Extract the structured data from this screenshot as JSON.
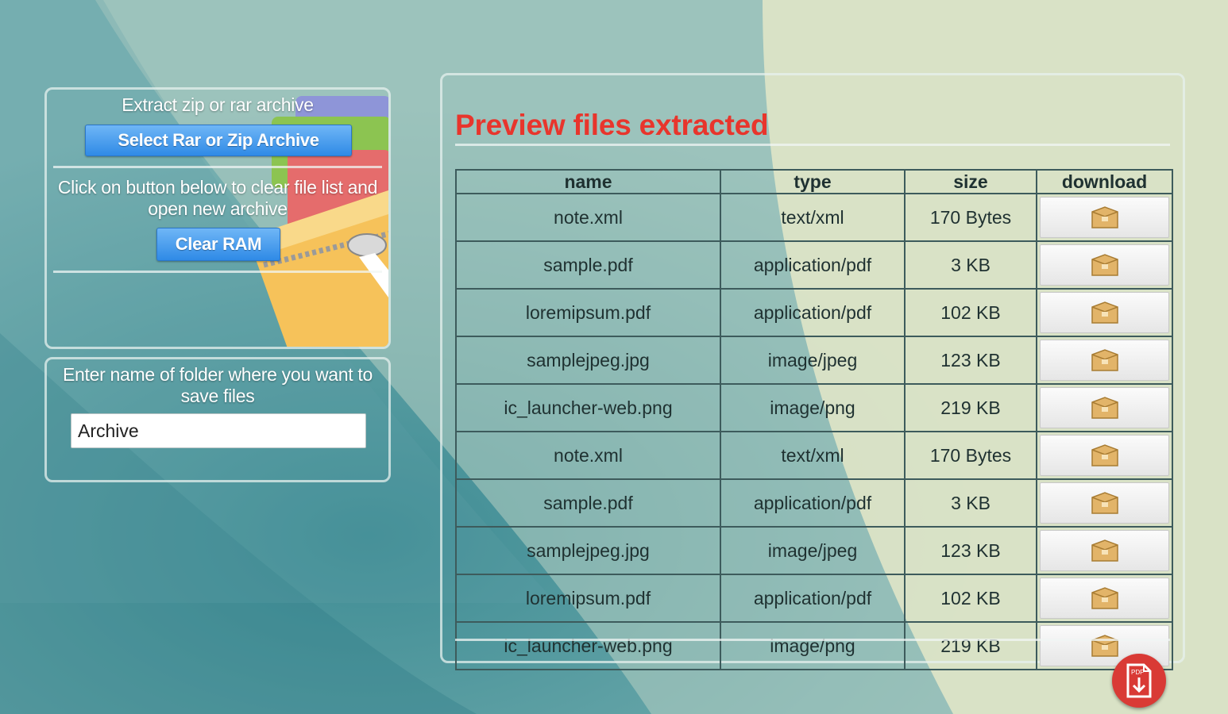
{
  "extract": {
    "title": "Extract zip or rar archive",
    "select_button": "Select Rar or Zip Archive",
    "clear_instruction": "Click on button below to clear file list and open new archive",
    "clear_button": "Clear RAM"
  },
  "folder": {
    "instruction": "Enter name of folder where you want to save files",
    "value": "Archive"
  },
  "preview": {
    "title": "Preview files extracted",
    "columns": [
      "name",
      "type",
      "size",
      "download"
    ],
    "rows": [
      {
        "name": "note.xml",
        "type": "text/xml",
        "size": "170 Bytes"
      },
      {
        "name": "sample.pdf",
        "type": "application/pdf",
        "size": "3 KB"
      },
      {
        "name": "loremipsum.pdf",
        "type": "application/pdf",
        "size": "102 KB"
      },
      {
        "name": "samplejpeg.jpg",
        "type": "image/jpeg",
        "size": "123 KB"
      },
      {
        "name": "ic_launcher-web.png",
        "type": "image/png",
        "size": "219 KB"
      },
      {
        "name": "note.xml",
        "type": "text/xml",
        "size": "170 Bytes"
      },
      {
        "name": "sample.pdf",
        "type": "application/pdf",
        "size": "3 KB"
      },
      {
        "name": "samplejpeg.jpg",
        "type": "image/jpeg",
        "size": "123 KB"
      },
      {
        "name": "loremipsum.pdf",
        "type": "application/pdf",
        "size": "102 KB"
      },
      {
        "name": "ic_launcher-web.png",
        "type": "image/png",
        "size": "219 KB"
      }
    ],
    "download_icon": "box-download-icon"
  },
  "fab": {
    "icon": "pdf-save-icon"
  },
  "colors": {
    "title_red": "#e8352c",
    "button_blue": "#2f8ae6",
    "fab_red": "#d93a35"
  }
}
